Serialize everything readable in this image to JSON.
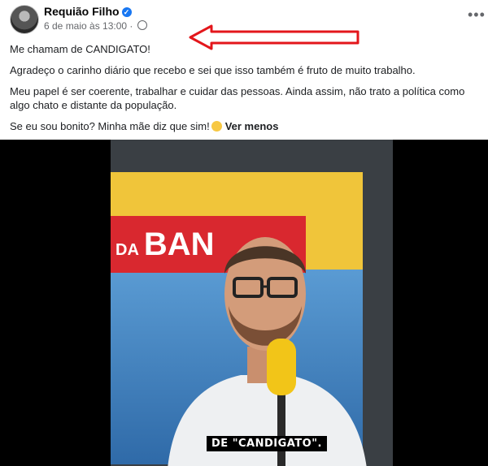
{
  "post": {
    "author": "Requião Filho",
    "timestamp": "6 de maio às 13:00",
    "more_options_icon": "ellipsis-icon",
    "lines": [
      "Me chamam de CANDIGATO!",
      "Agradeço o carinho diário que recebo e sei que isso também é fruto de muito trabalho.",
      "Meu papel é ser coerente, trabalhar e cuidar das pessoas. Ainda assim, não trato a política como algo chato e distante da população.",
      "Se eu sou bonito? Minha mãe diz que sim!"
    ],
    "see_less": "Ver menos"
  },
  "video": {
    "banner_prefix": "DA",
    "banner_text": "BAN",
    "caption": "DE \"CANDIGATO\"."
  },
  "colors": {
    "verified": "#1877f2",
    "arrow": "#e3161b",
    "banner_red": "#d9282f",
    "panel_yellow": "#f0c53a",
    "panel_blue": "#3d7fc0"
  }
}
